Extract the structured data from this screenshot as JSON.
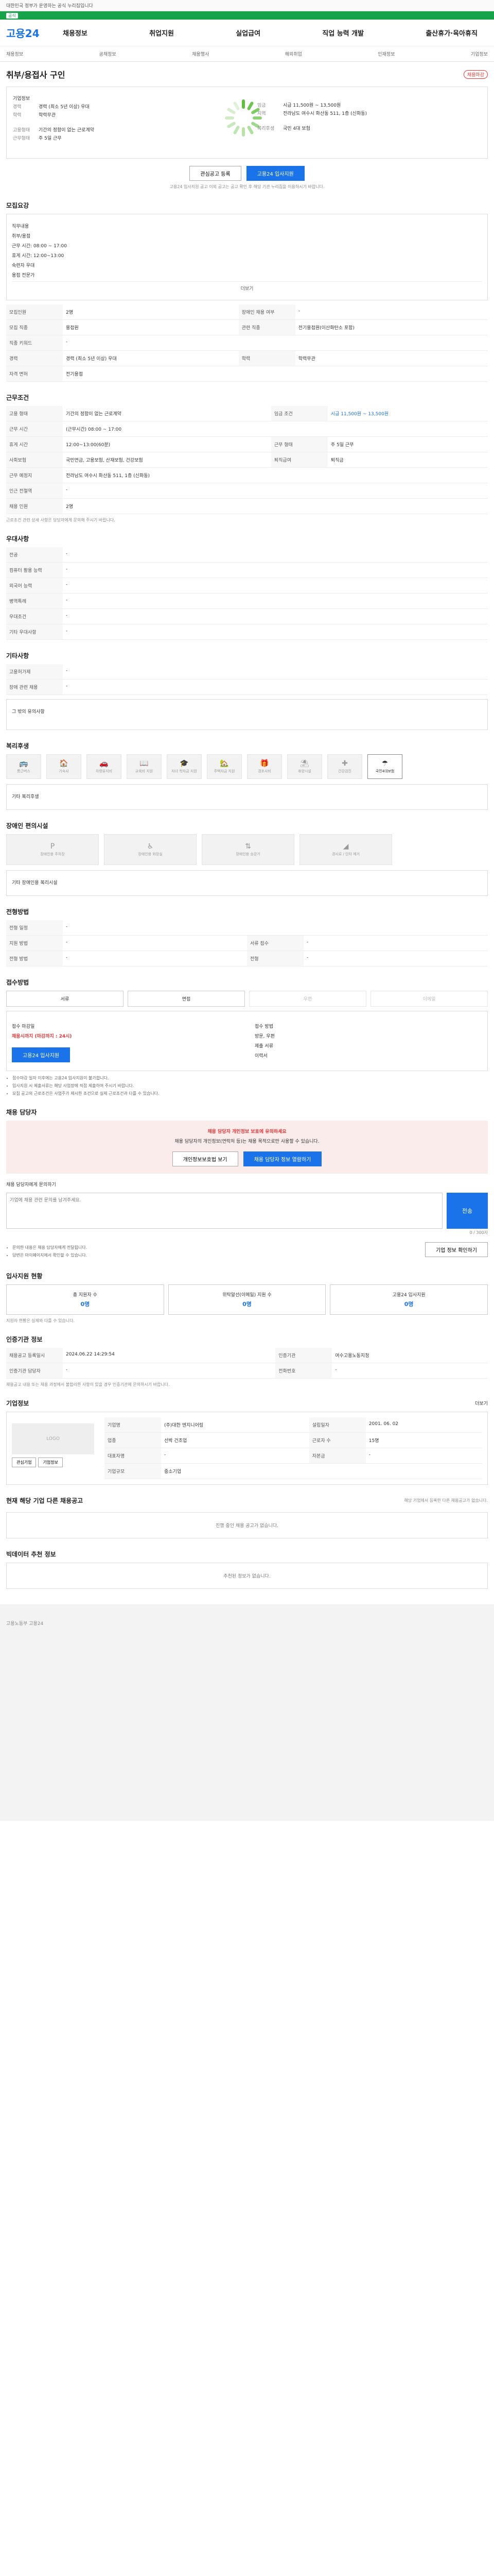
{
  "topbar": {
    "left": "대한민국 정부가 운영하는 공식 누리집입니다",
    "right": ""
  },
  "gov": {
    "tag": "공식",
    "text": ""
  },
  "header": {
    "logo": "고용24",
    "gnb": [
      "채용정보",
      "취업지원",
      "실업급여",
      "직업 능력 개발",
      "출산휴가·육아휴직"
    ]
  },
  "subnav": [
    "채용정보",
    "공채정보",
    "채용행사",
    "해외취업",
    "인재정보",
    "기업정보"
  ],
  "job": {
    "title": "취부/용접사 구인",
    "badge": "채용마감",
    "company_label": "기업정보",
    "fields": [
      {
        "label": "경력",
        "value": "경력 (최소 5년 이상) 우대"
      },
      {
        "label": "학력",
        "value": "학력무관"
      }
    ],
    "fields_right": [
      {
        "label": "임금",
        "value": "시급 11,500원 ~ 13,500원"
      },
      {
        "label": "지역",
        "value": "전라남도 여수시 화산동 511, 1층 (신화동)"
      }
    ],
    "fields2": [
      {
        "label": "고용형태",
        "value": "기간의 정함이 없는 근로계약"
      },
      {
        "label": "근무형태",
        "value": "주 5일 근무"
      }
    ],
    "fields2_right": [
      {
        "label": "복리후생",
        "value": "국민 4대 보험"
      }
    ],
    "btn_scrap": "관심공고 등록",
    "btn_apply": "고용24 입사지원",
    "notice": "고용24 입사지원 공고 이외 공고는 공고 확인 후 해당 기관 누리집을 이용하시기 바랍니다."
  },
  "recruit": {
    "heading": "모집요강",
    "duty_label": "직무내용",
    "duties": [
      "취부/용접",
      "근무 시간: 08:00 ~ 17:00",
      "휴게 시간: 12:00~13:00",
      "숙련자 우대",
      "용접 전문가"
    ],
    "more": "더보기",
    "rows": [
      [
        "모집인원",
        "2명",
        "장애인 채용 여부",
        "-"
      ],
      [
        "모집 직종",
        "용접원",
        "관련 직종",
        "전기용접원(이산화탄소 포함)"
      ],
      [
        "직종 키워드",
        "-",
        "",
        ""
      ],
      [
        "경력",
        "경력 (최소 5년 이상) 우대",
        "학력",
        "학력무관"
      ],
      [
        "자격 면허",
        "전기용접",
        "",
        ""
      ]
    ]
  },
  "conditions": {
    "heading": "근무조건",
    "rows": [
      [
        "고용 형태",
        "기간의 정함이 없는 근로계약",
        "임금 조건",
        "시급 11,500원 ~ 13,500원"
      ],
      [
        "근무 시간",
        "(근무시간) 08:00 ~ 17:00",
        "",
        ""
      ],
      [
        "휴게 시간",
        "12:00~13:00(60분)",
        "근무 형태",
        "주 5일 근무"
      ],
      [
        "사회보험",
        "국민연금, 고용보험, 산재보험, 건강보험",
        "퇴직급여",
        "퇴직금"
      ],
      [
        "근무 예정지",
        "전라남도 여수시 화산동 511, 1층 (신화동)",
        "",
        ""
      ],
      [
        "인근 전철역",
        "-",
        "",
        ""
      ],
      [
        "채용 인원",
        "2명",
        "",
        ""
      ]
    ],
    "footnote": "근로조건 관련 상세 사항은 담당자에게 문의해 주시기 바랍니다."
  },
  "prefer": {
    "heading": "우대사항",
    "rows": [
      [
        "전공",
        "-"
      ],
      [
        "컴퓨터 활용 능력",
        "-"
      ],
      [
        "외국어 능력",
        "-"
      ],
      [
        "병역특례",
        "-"
      ],
      [
        "우대조건",
        "-"
      ],
      [
        "기타 우대사항",
        "-"
      ]
    ]
  },
  "etc": {
    "heading": "기타사항",
    "rows": [
      [
        "고용허가제",
        "-"
      ],
      [
        "장애 관련 채용",
        "-"
      ]
    ],
    "other_label": "그 밖의 유의사항"
  },
  "welfare": {
    "heading": "복리후생",
    "items": [
      "통근버스",
      "기숙사",
      "차량유지비",
      "교육비 지원",
      "자녀 학자금 지원",
      "주택자금 지원",
      "경조사비",
      "휴양시설",
      "건강검진",
      "국민4대보험"
    ],
    "on_index": 9,
    "other_label": "기타 복리후생"
  },
  "disability": {
    "heading": "장애인 편의시설",
    "items": [
      "장애인용 주차장",
      "장애인용 화장실",
      "장애인용 승강기",
      "경사로 / 단차 제거"
    ],
    "other_label": "기타 장애인용 복리시설"
  },
  "process": {
    "heading": "전형방법",
    "rows": [
      [
        "전형 일정",
        "-"
      ],
      [
        "지원 방법",
        "-"
      ],
      [
        "전형 방법",
        "-"
      ]
    ],
    "right": [
      [
        "서류 접수",
        "-"
      ],
      [
        "전형",
        "-"
      ]
    ]
  },
  "apply": {
    "heading": "접수방법",
    "methods": [
      "서류",
      "면접",
      "우편",
      "이메일"
    ],
    "deadline_label": "접수 마감일",
    "deadline": "채용시까지 (마감까지 : 24시)",
    "apply_label": "접수 방법",
    "apply_value": "방문, 우편",
    "docs_label": "제출 서류",
    "docs_value": "이력서",
    "btn": "고용24 입사지원",
    "notes": [
      "접수마감 일자 이후에는 고용24 입사지원이 불가합니다.",
      "입사지원 시 제출서류는 해당 사업장에 직접 제출하여 주시기 바랍니다.",
      "모집 공고의 근로조건은 사업주가 제시한 조건으로 실제 근로조건과 다를 수 있습니다."
    ]
  },
  "contact": {
    "heading": "채용 담당자",
    "warn_title": "채용 담당자 개인정보 보호에 유의하세요",
    "warn_body": "채용 담당자의 개인정보(연락처 등)는 채용 목적으로만 사용할 수 있습니다.",
    "btn_a": "개인정보보호법 보기",
    "btn_b": "채용 담당자 정보 열람하기",
    "qna_label": "채용 담당자에게 문의하기",
    "qna_placeholder": "기업에 채용 관련 문의를 남겨주세요.",
    "qna_count": "0 / 300자",
    "send": "전송",
    "notes": [
      "문의한 내용은 채용 담당자에게 전달됩니다.",
      "답변은 마이페이지에서 확인할 수 있습니다."
    ],
    "btn_check": "기업 정보 확인하기"
  },
  "stats": {
    "heading": "입사지원 현황",
    "items": [
      {
        "label": "총 지원자 수",
        "value": "0명"
      },
      {
        "label": "위탁알선(이메일) 지원 수",
        "value": "0명"
      },
      {
        "label": "고용24 입사지원",
        "value": "0명"
      }
    ],
    "note": "지원자 현황은 실제와 다를 수 있습니다."
  },
  "agency": {
    "heading": "인증기관 정보",
    "rows": [
      [
        "채용공고 등록일시",
        "2024.06.22 14:29:54",
        "인증기관",
        "여수고용노동지청"
      ],
      [
        "인증기관 담당자",
        "-",
        "전화번호",
        "-"
      ]
    ],
    "note": "채용공고 내용 또는 채용 과정에서 불합리한 사항이 있을 경우 인증기관에 문의하시기 바랍니다."
  },
  "company": {
    "heading": "기업정보",
    "more": "더보기",
    "logo_text": "LOGO",
    "btn_a": "관심기업",
    "btn_b": "기업정보",
    "rows": [
      [
        "기업명",
        "(주)대한 엔지니어링",
        "설립일자",
        "2001. 06. 02"
      ],
      [
        "업종",
        "선박 건조업",
        "근로자 수",
        "15명"
      ],
      [
        "대표자명",
        "-",
        "자본금",
        "-"
      ],
      [
        "기업규모",
        "중소기업",
        "",
        ""
      ]
    ],
    "btn_detail": "기업정보 더보기"
  },
  "similar": {
    "heading": "현재 해당 기업 다른 채용공고",
    "sub": "해당 기업에서 등록한 다른 채용공고가 없습니다.",
    "empty": "진행 중인 채용 공고가 없습니다."
  },
  "recommend": {
    "heading": "빅데이터 추천 정보",
    "empty": "추천된 정보가 없습니다."
  },
  "footer": {
    "text": "고용노동부 고용24"
  }
}
